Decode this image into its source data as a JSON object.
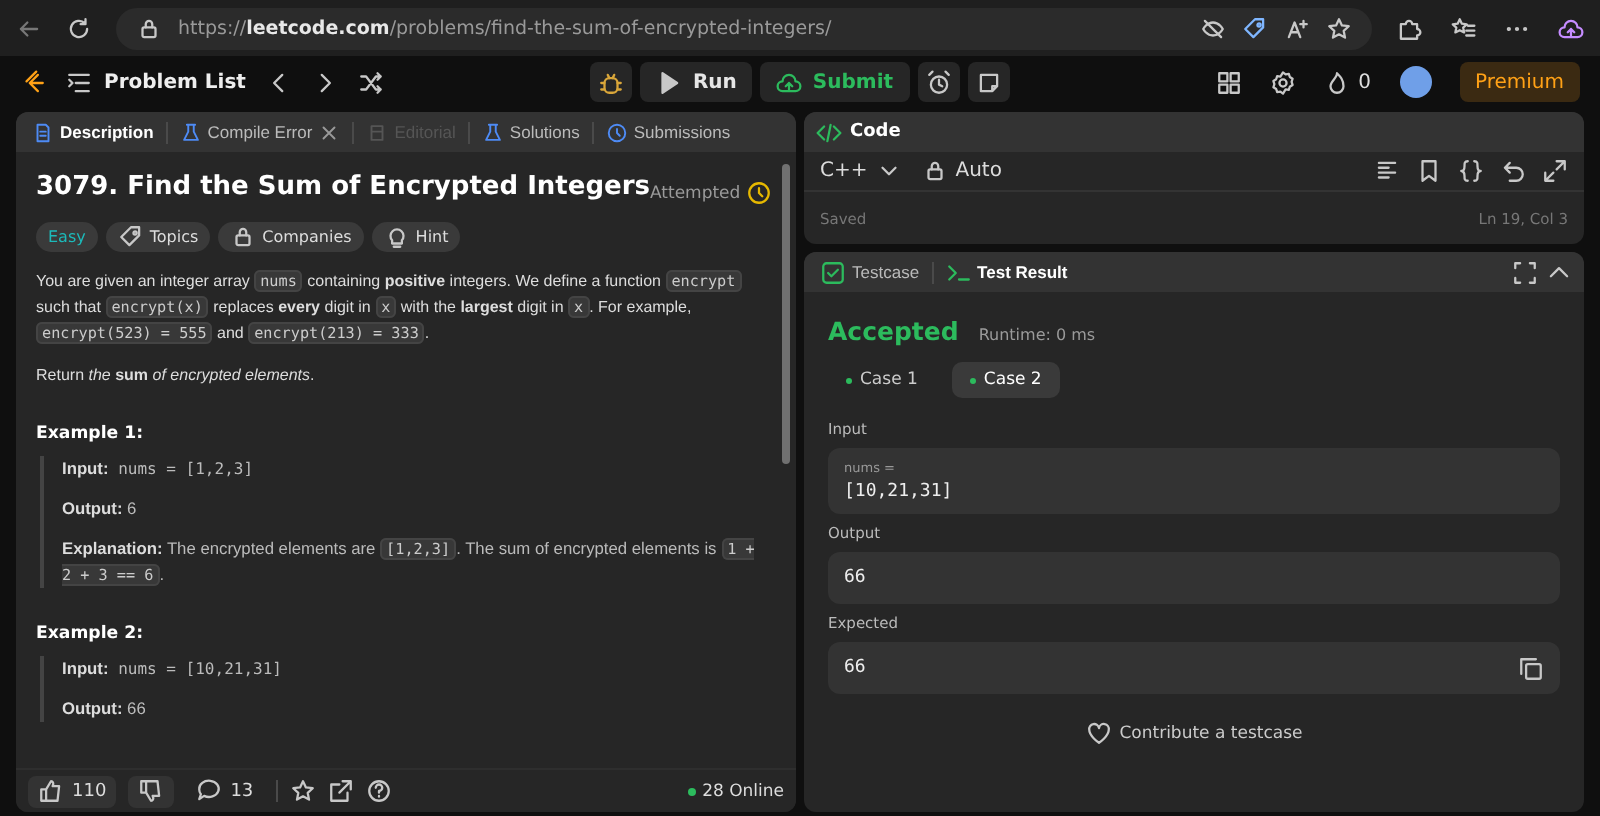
{
  "browser": {
    "url": "https://**leetcode.com**/problems/find-the-sum-of-encrypted-integers/"
  },
  "nav": {
    "problem_list": "Problem List",
    "run": "Run",
    "submit": "Submit",
    "streak": "0",
    "premium": "Premium"
  },
  "description_panel": {
    "tabs": [
      {
        "label": "Description",
        "selected": true,
        "disabled": false,
        "closable": false
      },
      {
        "label": "Compile Error",
        "selected": false,
        "disabled": false,
        "closable": true
      },
      {
        "label": "Editorial",
        "selected": false,
        "disabled": true,
        "closable": false
      },
      {
        "label": "Solutions",
        "selected": false,
        "disabled": false,
        "closable": false
      },
      {
        "label": "Submissions",
        "selected": false,
        "disabled": false,
        "closable": false
      }
    ],
    "title": "3079. Find the Sum of Encrypted Integers",
    "status": "Attempted",
    "tags": [
      {
        "kind": "difficulty",
        "label": "Easy"
      },
      {
        "kind": "topics",
        "label": "Topics"
      },
      {
        "kind": "companies",
        "label": "Companies"
      },
      {
        "kind": "hint",
        "label": "Hint"
      }
    ],
    "paragraphs": [
      [
        {
          "kind": "text",
          "text": "You are given an integer array "
        },
        {
          "kind": "code",
          "text": "nums"
        },
        {
          "kind": "text",
          "text": " containing **positive** integers. We define a function "
        },
        {
          "kind": "code",
          "text": "encrypt"
        },
        {
          "kind": "text",
          "text": " such that "
        },
        {
          "kind": "code",
          "text": "encrypt(x)"
        },
        {
          "kind": "text",
          "text": " replaces **every** digit in "
        },
        {
          "kind": "code",
          "text": "x"
        },
        {
          "kind": "text",
          "text": " with the **largest** digit in "
        },
        {
          "kind": "code",
          "text": "x"
        },
        {
          "kind": "text",
          "text": ". For example, "
        },
        {
          "kind": "code",
          "text": "encrypt(523) = 555"
        },
        {
          "kind": "text",
          "text": " and "
        },
        {
          "kind": "code",
          "text": "encrypt(213) = 333"
        },
        {
          "kind": "text",
          "text": "."
        }
      ],
      [
        {
          "kind": "text",
          "text": "Return *the* **sum** *of encrypted elements*."
        }
      ]
    ],
    "examples": [
      {
        "title": "Example 1:",
        "lines": [
          {
            "label": "Input:",
            "segments": [
              {
                "kind": "mono",
                "text": " nums = [1,2,3]"
              }
            ]
          },
          {
            "label": "Output:",
            "segments": [
              {
                "kind": "text",
                "text": " 6"
              }
            ]
          },
          {
            "label": "Explanation:",
            "segments": [
              {
                "kind": "text",
                "text": " The encrypted elements are "
              },
              {
                "kind": "code",
                "text": "[1,2,3]"
              },
              {
                "kind": "text",
                "text": ". The sum of encrypted elements is "
              },
              {
                "kind": "code",
                "text": "1 + 2 + 3 == 6"
              },
              {
                "kind": "text",
                "text": "."
              }
            ]
          }
        ]
      },
      {
        "title": "Example 2:",
        "lines": [
          {
            "label": "Input:",
            "segments": [
              {
                "kind": "mono",
                "text": " nums = [10,21,31]"
              }
            ]
          },
          {
            "label": "Output:",
            "segments": [
              {
                "kind": "text",
                "text": " 66"
              }
            ]
          }
        ]
      }
    ],
    "footer": {
      "likes": "110",
      "comments": "13",
      "online": "28 Online"
    }
  },
  "code_panel": {
    "title": "Code",
    "language": "C++",
    "mode": "Auto",
    "saved": "Saved",
    "cursor": "Ln 19, Col 3"
  },
  "result_panel": {
    "tabs": [
      {
        "label": "Testcase",
        "selected": false
      },
      {
        "label": "Test Result",
        "selected": true
      }
    ],
    "verdict": "Accepted",
    "runtime": "Runtime: 0 ms",
    "cases": [
      {
        "label": "Case 1",
        "selected": false
      },
      {
        "label": "Case 2",
        "selected": true
      }
    ],
    "input_label": "Input",
    "input_var": "nums =",
    "input_value": "[10,21,31]",
    "output_label": "Output",
    "output_value": "66",
    "expected_label": "Expected",
    "expected_value": "66",
    "contribute": "Contribute a testcase"
  }
}
